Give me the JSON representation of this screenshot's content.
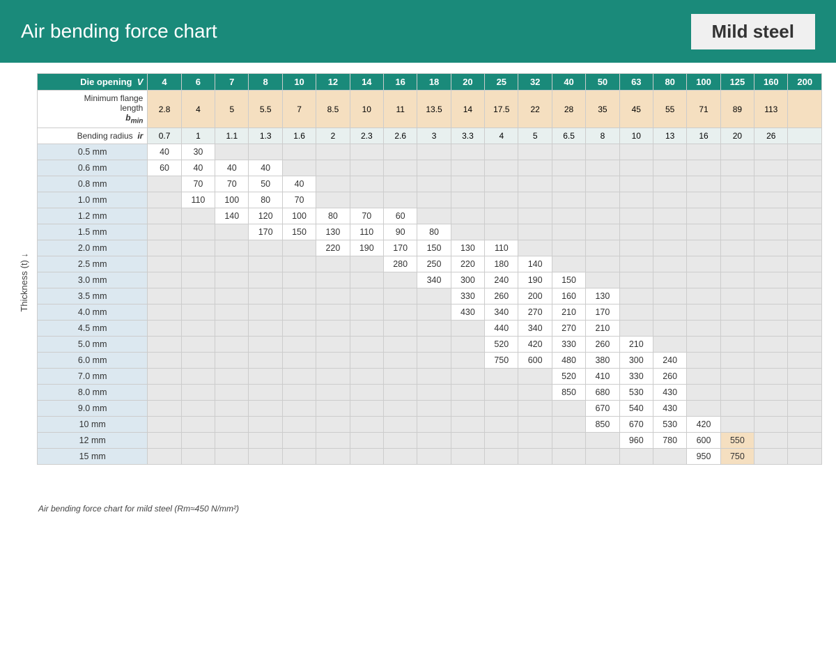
{
  "header": {
    "title": "Air bending force chart",
    "subtitle": "Mild steel"
  },
  "labels": {
    "die_opening": "Die opening",
    "die_opening_var": "V",
    "min_flange": "Minimum flange length",
    "min_flange_var": "b",
    "min_flange_sub": "min",
    "bending_radius": "Bending radius",
    "bending_radius_var": "ir",
    "thickness": "Thickness (t) ↓",
    "footnote": "Air bending force chart for mild steel (Rm≈450 N/mm²)"
  },
  "die_openings": [
    4,
    6,
    7,
    8,
    10,
    12,
    14,
    16,
    18,
    20,
    25,
    32,
    40,
    50,
    63,
    80,
    100,
    125,
    160,
    200
  ],
  "min_flanges": [
    2.8,
    4,
    5,
    5.5,
    7,
    8.5,
    10,
    11,
    13.5,
    14,
    17.5,
    22,
    28,
    35,
    45,
    55,
    71,
    89,
    113,
    ""
  ],
  "bending_radii": [
    0.7,
    1.0,
    1.1,
    1.3,
    1.6,
    2.0,
    2.3,
    2.6,
    3.0,
    3.3,
    4.0,
    5.0,
    6.5,
    8.0,
    10,
    13,
    16,
    20,
    26,
    ""
  ],
  "thickness_rows": [
    {
      "label": "0.5 mm",
      "values": [
        40,
        30,
        "",
        "",
        "",
        "",
        "",
        "",
        "",
        "",
        "",
        "",
        "",
        "",
        "",
        "",
        "",
        "",
        "",
        ""
      ]
    },
    {
      "label": "0.6 mm",
      "values": [
        60,
        40,
        40,
        40,
        "",
        "",
        "",
        "",
        "",
        "",
        "",
        "",
        "",
        "",
        "",
        "",
        "",
        "",
        "",
        ""
      ]
    },
    {
      "label": "0.8 mm",
      "values": [
        "",
        70,
        70,
        50,
        40,
        "",
        "",
        "",
        "",
        "",
        "",
        "",
        "",
        "",
        "",
        "",
        "",
        "",
        "",
        ""
      ]
    },
    {
      "label": "1.0 mm",
      "values": [
        "",
        110,
        100,
        80,
        70,
        "",
        "",
        "",
        "",
        "",
        "",
        "",
        "",
        "",
        "",
        "",
        "",
        "",
        "",
        ""
      ]
    },
    {
      "label": "1.2 mm",
      "values": [
        "",
        "",
        140,
        120,
        100,
        80,
        70,
        60,
        "",
        "",
        "",
        "",
        "",
        "",
        "",
        "",
        "",
        "",
        "",
        ""
      ]
    },
    {
      "label": "1.5 mm",
      "values": [
        "",
        "",
        "",
        170,
        150,
        130,
        110,
        90,
        80,
        "",
        "",
        "",
        "",
        "",
        "",
        "",
        "",
        "",
        "",
        ""
      ]
    },
    {
      "label": "2.0 mm",
      "values": [
        "",
        "",
        "",
        "",
        "",
        220,
        190,
        170,
        150,
        130,
        110,
        "",
        "",
        "",
        "",
        "",
        "",
        "",
        "",
        ""
      ]
    },
    {
      "label": "2.5 mm",
      "values": [
        "",
        "",
        "",
        "",
        "",
        "",
        "",
        280,
        250,
        220,
        180,
        140,
        "",
        "",
        "",
        "",
        "",
        "",
        "",
        ""
      ]
    },
    {
      "label": "3.0 mm",
      "values": [
        "",
        "",
        "",
        "",
        "",
        "",
        "",
        "",
        340,
        300,
        240,
        190,
        150,
        "",
        "",
        "",
        "",
        "",
        "",
        ""
      ]
    },
    {
      "label": "3.5 mm",
      "values": [
        "",
        "",
        "",
        "",
        "",
        "",
        "",
        "",
        "",
        330,
        260,
        200,
        160,
        130,
        "",
        "",
        "",
        "",
        "",
        ""
      ]
    },
    {
      "label": "4.0 mm",
      "values": [
        "",
        "",
        "",
        "",
        "",
        "",
        "",
        "",
        "",
        430,
        340,
        270,
        210,
        170,
        "",
        "",
        "",
        "",
        "",
        ""
      ]
    },
    {
      "label": "4.5 mm",
      "values": [
        "",
        "",
        "",
        "",
        "",
        "",
        "",
        "",
        "",
        "",
        440,
        340,
        270,
        210,
        "",
        "",
        "",
        "",
        "",
        ""
      ]
    },
    {
      "label": "5.0 mm",
      "values": [
        "",
        "",
        "",
        "",
        "",
        "",
        "",
        "",
        "",
        "",
        520,
        420,
        330,
        260,
        210,
        "",
        "",
        "",
        "",
        ""
      ]
    },
    {
      "label": "6.0 mm",
      "values": [
        "",
        "",
        "",
        "",
        "",
        "",
        "",
        "",
        "",
        "",
        750,
        600,
        480,
        380,
        300,
        240,
        "",
        "",
        "",
        ""
      ]
    },
    {
      "label": "7.0 mm",
      "values": [
        "",
        "",
        "",
        "",
        "",
        "",
        "",
        "",
        "",
        "",
        "",
        "",
        520,
        410,
        330,
        260,
        "",
        "",
        "",
        ""
      ]
    },
    {
      "label": "8.0 mm",
      "values": [
        "",
        "",
        "",
        "",
        "",
        "",
        "",
        "",
        "",
        "",
        "",
        "",
        850,
        680,
        530,
        430,
        "",
        "",
        "",
        ""
      ]
    },
    {
      "label": "9.0 mm",
      "values": [
        "",
        "",
        "",
        "",
        "",
        "",
        "",
        "",
        "",
        "",
        "",
        "",
        "",
        670,
        540,
        430,
        "",
        "",
        "",
        ""
      ]
    },
    {
      "label": "10 mm",
      "values": [
        "",
        "",
        "",
        "",
        "",
        "",
        "",
        "",
        "",
        "",
        "",
        "",
        "",
        850,
        670,
        530,
        420,
        "",
        "",
        ""
      ]
    },
    {
      "label": "12 mm",
      "values": [
        "",
        "",
        "",
        "",
        "",
        "",
        "",
        "",
        "",
        "",
        "",
        "",
        "",
        "",
        960,
        780,
        600,
        550,
        "",
        ""
      ]
    },
    {
      "label": "15 mm",
      "values": [
        "",
        "",
        "",
        "",
        "",
        "",
        "",
        "",
        "",
        "",
        "",
        "",
        "",
        "",
        "",
        "",
        950,
        750,
        "",
        ""
      ]
    }
  ]
}
